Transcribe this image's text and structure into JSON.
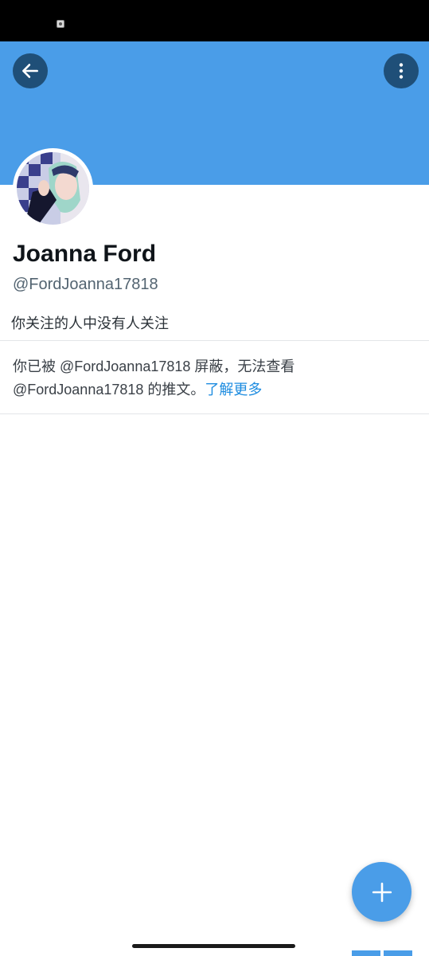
{
  "status_bar": {
    "icons": [
      "screen-record-icon"
    ]
  },
  "header": {
    "back_icon": "arrow-left-icon",
    "more_icon": "more-vertical-icon",
    "banner_color": "#4a9de8"
  },
  "profile": {
    "avatar": "profile-avatar",
    "display_name": "Joanna Ford",
    "handle": "@FordJoanna17818",
    "followers_note": "你关注的人中没有人关注"
  },
  "blocked_notice": {
    "line1": "你已被 @FordJoanna17818 屏蔽，无法查看",
    "line2": "@FordJoanna17818 的推文。",
    "learn_more": "了解更多",
    "link_color": "#1d8ce0"
  },
  "fab": {
    "icon": "plus-icon",
    "color": "#4a9de8"
  }
}
